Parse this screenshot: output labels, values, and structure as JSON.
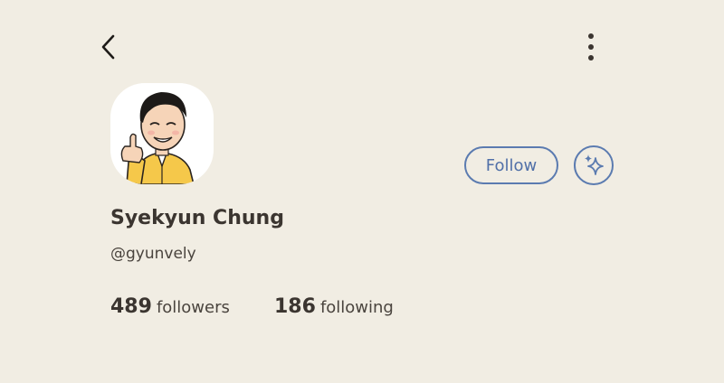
{
  "header": {
    "back_icon": "chevron-left-icon",
    "more_icon": "vertical-dots-icon"
  },
  "profile": {
    "avatar_description_icon": "cartoon-avatar-thumbs-up",
    "name": "Syekyun Chung",
    "handle": "@gyunvely",
    "follow_label": "Follow",
    "ai_icon": "sparkle-icon"
  },
  "stats": {
    "followers_count": "489",
    "followers_label": "followers",
    "following_count": "186",
    "following_label": "following"
  },
  "colors": {
    "background": "#f1ede3",
    "accent": "#5b7bb0",
    "text": "#3b3530"
  }
}
